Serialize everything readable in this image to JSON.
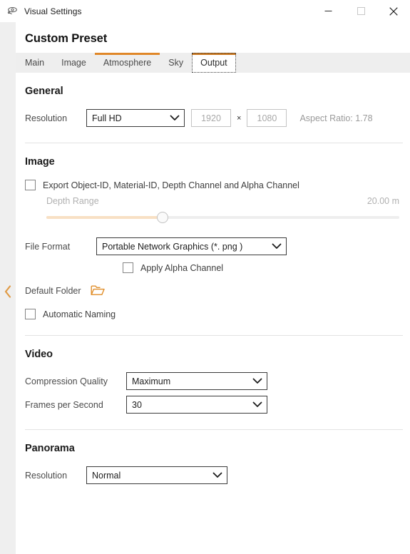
{
  "window": {
    "title": "Visual Settings",
    "icon": "visual-settings-icon",
    "controls": {
      "minimize": "minimize-icon",
      "maximize": "maximize-icon",
      "close": "close-icon"
    },
    "collapse_arrow": "chevron-left-icon"
  },
  "preset": {
    "title": "Custom Preset"
  },
  "tabs": [
    {
      "label": "Main",
      "state": "normal"
    },
    {
      "label": "Image",
      "state": "normal"
    },
    {
      "label": "Atmosphere",
      "state": "hovered"
    },
    {
      "label": "Sky",
      "state": "normal"
    },
    {
      "label": "Output",
      "state": "selected"
    }
  ],
  "sections": {
    "general": {
      "title": "General",
      "resolution_label": "Resolution",
      "resolution_value": "Full HD",
      "width_value": "1920",
      "height_value": "1080",
      "times_symbol": "×",
      "aspect_ratio": "Aspect Ratio: 1.78"
    },
    "image": {
      "title": "Image",
      "export_channels_label": "Export Object-ID, Material-ID, Depth Channel and Alpha Channel",
      "export_channels_checked": false,
      "depth_range_label": "Depth Range",
      "depth_range_value": "20.00 m",
      "depth_range_percent": 33,
      "file_format_label": "File Format",
      "file_format_value": "Portable Network Graphics  (*. png )",
      "apply_alpha_label": "Apply Alpha Channel",
      "apply_alpha_checked": false,
      "default_folder_label": "Default Folder",
      "folder_icon": "folder-icon",
      "automatic_naming_label": "Automatic Naming",
      "automatic_naming_checked": false
    },
    "video": {
      "title": "Video",
      "compression_label": "Compression Quality",
      "compression_value": "Maximum",
      "fps_label": "Frames per Second",
      "fps_value": "30"
    },
    "panorama": {
      "title": "Panorama",
      "resolution_label": "Resolution",
      "resolution_value": "Normal"
    }
  },
  "colors": {
    "accent_orange": "#c9771f",
    "hover_orange": "#e08728",
    "slider_fill": "#f8e0c4",
    "folder_orange": "#e08e2a"
  }
}
